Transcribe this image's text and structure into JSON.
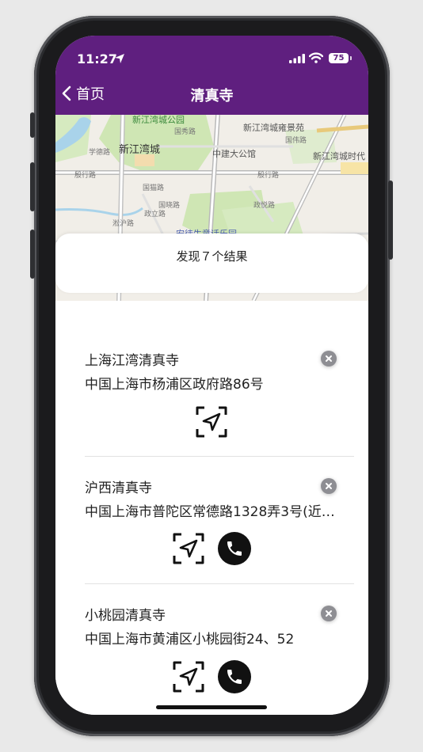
{
  "status_bar": {
    "time": "11:27",
    "battery": "75"
  },
  "nav": {
    "back_label": "首页",
    "title": "清真寺"
  },
  "map": {
    "labels": [
      "新江湾城公园",
      "国秀路",
      "学德路",
      "新江湾城",
      "中建大公馆",
      "新江湾城雍景苑",
      "国伟路",
      "新江湾城时代",
      "殷行路",
      "殷行路",
      "国晓路",
      "政悦路",
      "国猫路",
      "政立路",
      "安徒生童话乐园",
      "淞沪路"
    ]
  },
  "results": {
    "text": "发现７个结果"
  },
  "items": [
    {
      "name": "上海江湾清真寺",
      "address": "中国上海市杨浦区政府路86号",
      "has_phone": false
    },
    {
      "name": "沪西清真寺",
      "address": "中国上海市普陀区常德路1328弄3号(近…",
      "has_phone": true
    },
    {
      "name": "小桃园清真寺",
      "address": "中国上海市黄浦区小桃园街24、52",
      "has_phone": true
    }
  ],
  "colors": {
    "header": "#5f1f7f",
    "close_button": "#8e8e93"
  }
}
